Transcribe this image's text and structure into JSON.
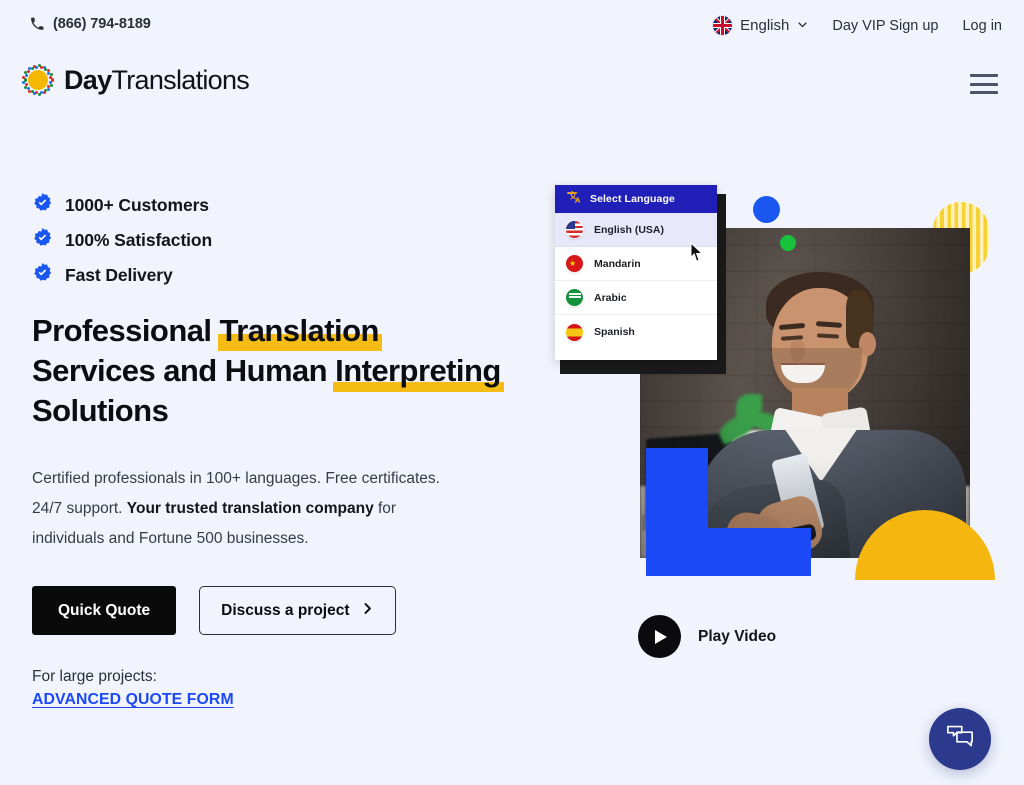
{
  "topbar": {
    "phone_icon": "phone-icon",
    "phone": "(866) 794-8189",
    "language": "English",
    "language_flag": "uk-flag-icon",
    "chevron": "chevron-down-icon",
    "vip_signup": "Day VIP Sign up",
    "login": "Log in"
  },
  "brand": {
    "logo_icon": "day-translations-sun-icon",
    "name_bold": "Day",
    "name_light": "Translations",
    "menu_icon": "hamburger-menu-icon"
  },
  "hero": {
    "features": [
      {
        "icon": "verified-check-icon",
        "label": "1000+ Customers"
      },
      {
        "icon": "verified-check-icon",
        "label": "100% Satisfaction"
      },
      {
        "icon": "verified-check-icon",
        "label": "Fast Delivery"
      }
    ],
    "headline": {
      "part1": "Professional ",
      "highlight1": "Translation",
      "part2": " Services and Human ",
      "highlight2": "Interpreting",
      "part3": " Solutions"
    },
    "lede": {
      "part1": "Certified professionals in 100+ languages. Free certificates. 24/7 support. ",
      "bold": "Your trusted translation company",
      "part2": " for individuals and Fortune 500 businesses."
    },
    "cta_primary": "Quick Quote",
    "cta_secondary": "Discuss a project",
    "cta_secondary_icon": "chevron-right-icon",
    "large_projects_label": "For large projects:",
    "advanced_quote_link": "ADVANCED QUOTE FORM"
  },
  "language_dropdown": {
    "header_icon": "translate-icon",
    "header": "Select Language",
    "items": [
      {
        "flag": "usa-flag-icon",
        "label": "English (USA)",
        "selected": true
      },
      {
        "flag": "china-flag-icon",
        "label": "Mandarin",
        "selected": false
      },
      {
        "flag": "saudi-arabia-flag-icon",
        "label": "Arabic",
        "selected": false
      },
      {
        "flag": "spain-flag-icon",
        "label": "Spanish",
        "selected": false
      }
    ],
    "cursor_icon": "mouse-pointer-icon"
  },
  "video": {
    "play_icon": "play-triangle-icon",
    "label": "Play Video"
  },
  "chat": {
    "icon": "chat-bubbles-icon"
  },
  "colors": {
    "background": "#f2f4fd",
    "accent_blue": "#1a49f5",
    "accent_yellow": "#f5bc15",
    "dropdown_header_blue": "#2020b8",
    "chat_fab_blue": "#2b3a8c",
    "link_blue": "#1a49f5",
    "text_dark": "#14151a"
  }
}
